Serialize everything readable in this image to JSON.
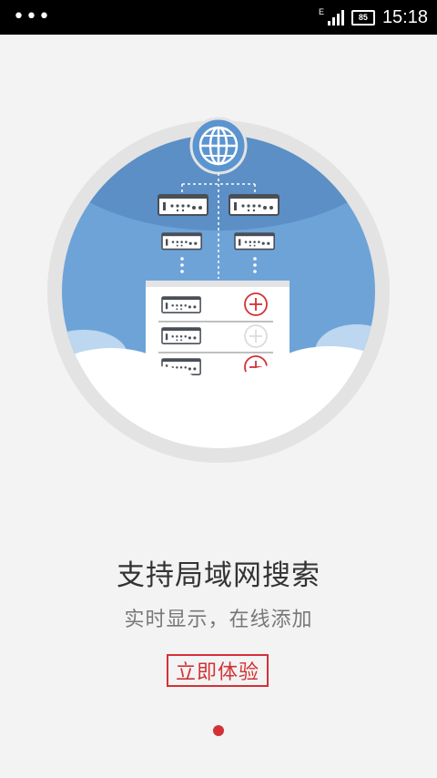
{
  "status_bar": {
    "time": "15:18",
    "battery": "85",
    "network_type": "E"
  },
  "onboarding": {
    "title": "支持局域网搜索",
    "subtitle": "实时显示，在线添加",
    "cta_label": "立即体验",
    "page_indicator": {
      "count": 1,
      "active_index": 0
    }
  },
  "colors": {
    "accent": "#d23237",
    "sky_blue": "#6ea3d8",
    "globe_blue": "#5b95d0",
    "background": "#f3f3f3"
  }
}
